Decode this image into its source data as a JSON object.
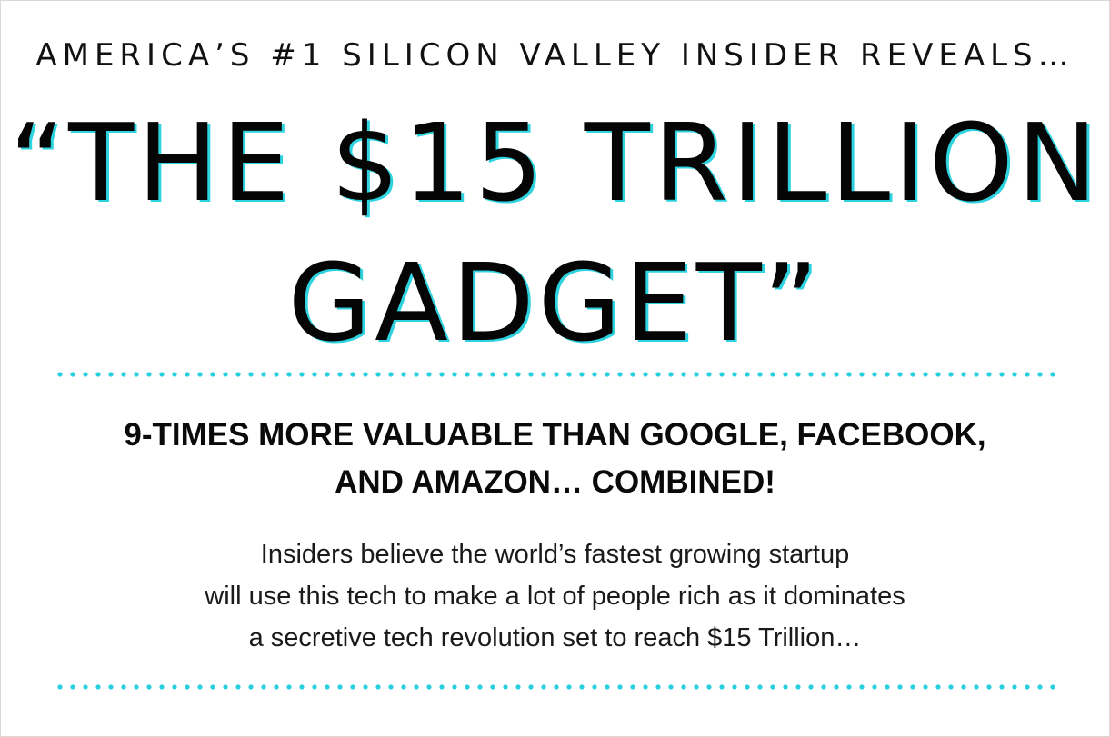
{
  "eyebrow": "AMERICA’S #1 SILICON VALLEY INSIDER REVEALS…",
  "headline": {
    "line1": "“THE $15 TRILLION",
    "line2": "GADGET”"
  },
  "subhead": {
    "line1": "9-TIMES MORE VALUABLE THAN GOOGLE, FACEBOOK,",
    "line2": "AND AMAZON… COMBINED!"
  },
  "body": {
    "line1": "Insiders believe the world’s fastest growing startup",
    "line2": "will use this tech to make a lot of people rich as it dominates",
    "line3": "a secretive tech revolution set to reach $15 Trillion…"
  },
  "colors": {
    "accent": "#29cfe0",
    "text": "#0a0a0a",
    "background": "#ffffff"
  }
}
